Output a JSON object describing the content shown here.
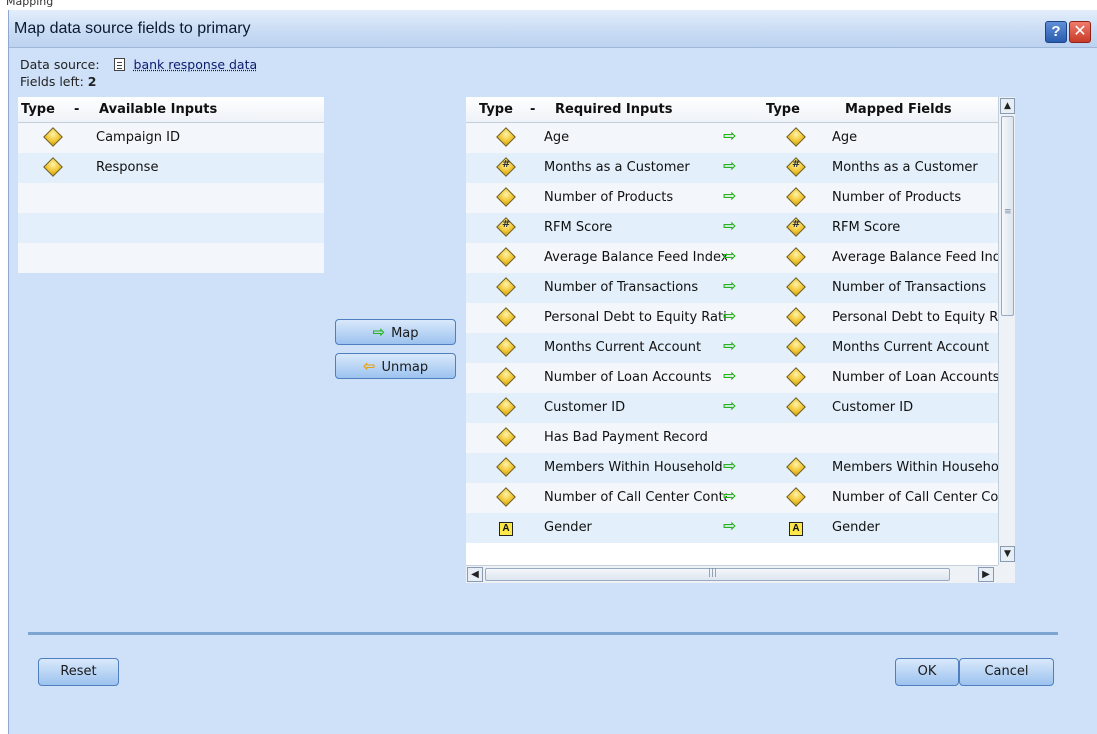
{
  "window": {
    "top_strip_text": "Mapping",
    "title": "Map data source fields to primary",
    "help_label": "?",
    "close_label": "✕"
  },
  "data_source": {
    "label": "Data source:",
    "value": "bank response data"
  },
  "fields_left": {
    "label": "Fields left:",
    "value": "2"
  },
  "available_inputs": {
    "headers": {
      "type": "Type",
      "sort": "-",
      "name": "Available Inputs"
    },
    "rows": [
      {
        "icon": "diamond-icon",
        "name": "Campaign ID"
      },
      {
        "icon": "diamond-icon",
        "name": "Response"
      }
    ]
  },
  "buttons": {
    "map": "Map",
    "unmap": "Unmap",
    "reset": "Reset",
    "ok": "OK",
    "cancel": "Cancel"
  },
  "required_inputs": {
    "headers": {
      "type": "Type",
      "sort": "-",
      "required": "Required Inputs",
      "mapped_type": "Type",
      "mapped": "Mapped Fields"
    },
    "rows": [
      {
        "type_icon": "diamond-icon",
        "required": "Age",
        "arrow": true,
        "mapped_icon": "diamond-icon",
        "mapped": "Age"
      },
      {
        "type_icon": "diamond-hash-icon",
        "required": "Months as a Customer",
        "arrow": true,
        "mapped_icon": "diamond-hash-icon",
        "mapped": "Months as a Customer"
      },
      {
        "type_icon": "diamond-icon",
        "required": "Number of Products",
        "arrow": true,
        "mapped_icon": "diamond-icon",
        "mapped": "Number of Products"
      },
      {
        "type_icon": "diamond-hash-icon",
        "required": "RFM Score",
        "arrow": true,
        "mapped_icon": "diamond-hash-icon",
        "mapped": "RFM Score"
      },
      {
        "type_icon": "diamond-icon",
        "required": "Average Balance Feed Index",
        "arrow": true,
        "mapped_icon": "diamond-icon",
        "mapped": "Average Balance Feed Index"
      },
      {
        "type_icon": "diamond-icon",
        "required": "Number of Transactions",
        "arrow": true,
        "mapped_icon": "diamond-icon",
        "mapped": "Number of Transactions"
      },
      {
        "type_icon": "diamond-icon",
        "required": "Personal Debt to Equity Ratio",
        "arrow": true,
        "mapped_icon": "diamond-icon",
        "mapped": "Personal Debt to Equity Ratio"
      },
      {
        "type_icon": "diamond-icon",
        "required": "Months Current Account",
        "arrow": true,
        "mapped_icon": "diamond-icon",
        "mapped": "Months Current Account"
      },
      {
        "type_icon": "diamond-icon",
        "required": "Number of Loan Accounts",
        "arrow": true,
        "mapped_icon": "diamond-icon",
        "mapped": "Number of Loan Accounts"
      },
      {
        "type_icon": "diamond-icon",
        "required": "Customer ID",
        "arrow": true,
        "mapped_icon": "diamond-icon",
        "mapped": "Customer ID"
      },
      {
        "type_icon": "diamond-icon",
        "required": "Has Bad Payment Record",
        "arrow": false,
        "mapped_icon": "",
        "mapped": ""
      },
      {
        "type_icon": "diamond-icon",
        "required": "Members Within Household",
        "arrow": true,
        "mapped_icon": "diamond-icon",
        "mapped": "Members Within Household"
      },
      {
        "type_icon": "diamond-icon",
        "required": "Number of Call Center Contacts",
        "arrow": true,
        "mapped_icon": "diamond-icon",
        "mapped": "Number of Call Center Contacts"
      },
      {
        "type_icon": "a-box-icon",
        "required": "Gender",
        "arrow": true,
        "mapped_icon": "a-box-icon",
        "mapped": "Gender"
      }
    ]
  },
  "scrollbar": {
    "up": "▲",
    "down": "▼",
    "left": "◀",
    "right": "▶",
    "grip": "≡",
    "hgrip": "|||"
  }
}
